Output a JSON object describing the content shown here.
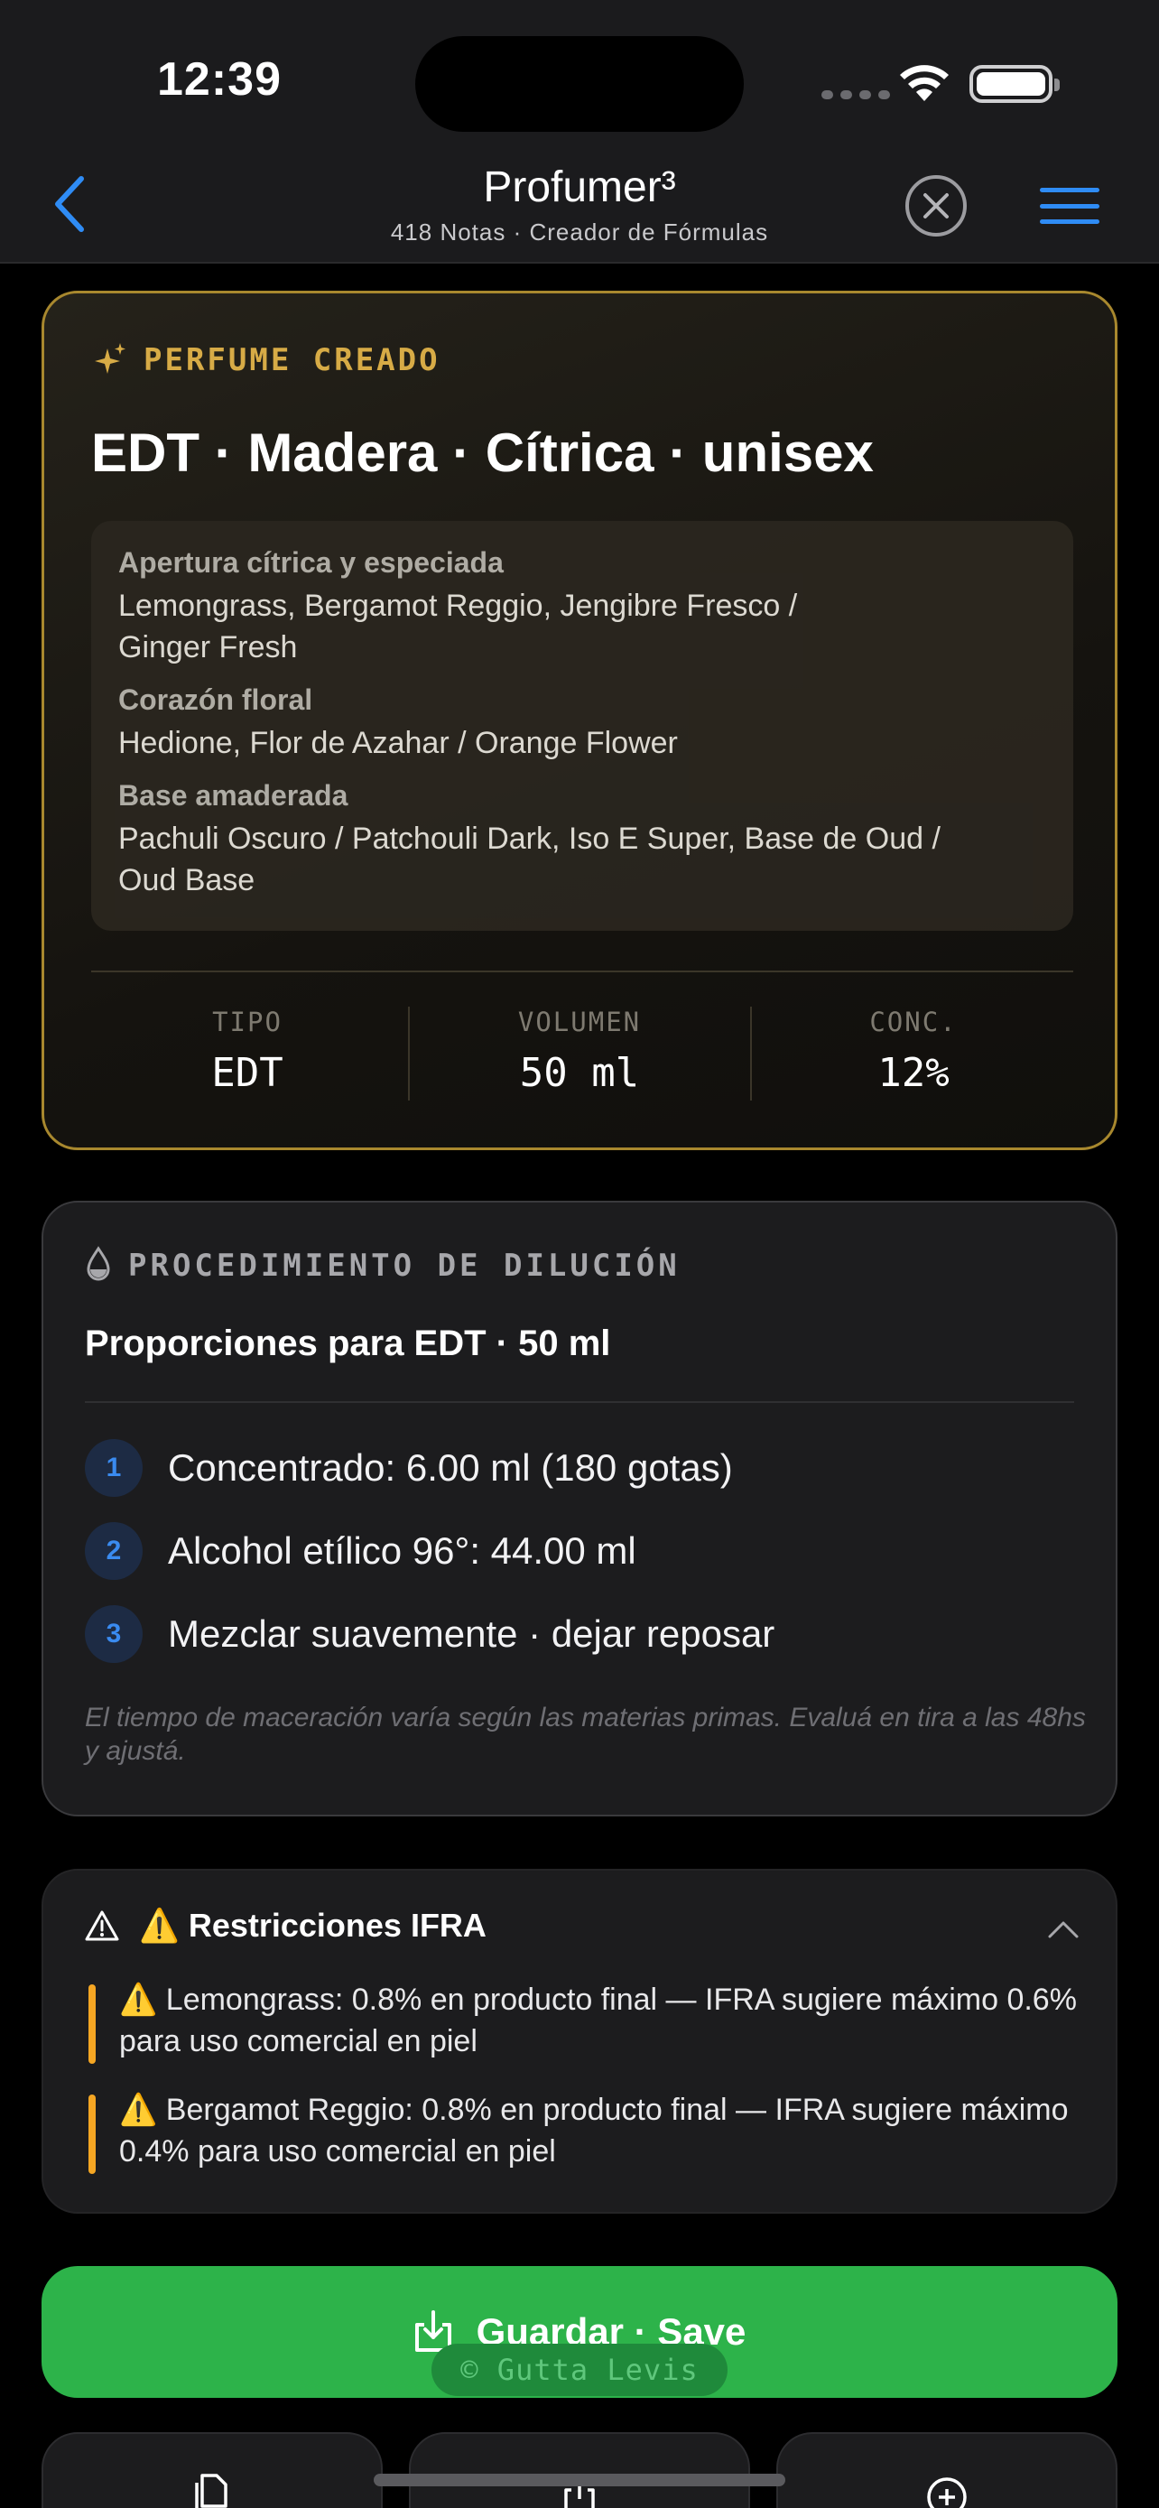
{
  "status_bar": {
    "time": "12:39"
  },
  "nav": {
    "title": "Profumer³",
    "subtitle": "418 Notas · Creador de Fórmulas"
  },
  "perfume": {
    "kicker": "PERFUME CREADO",
    "name": "EDT · Madera · Cítrica · unisex",
    "notes": [
      {
        "heading": "Apertura cítrica y especiada",
        "line1": "Lemongrass, Bergamot Reggio, Jengibre Fresco /",
        "line2": "Ginger Fresh"
      },
      {
        "heading": "Corazón floral",
        "line1": "Hedione, Flor de Azahar / Orange Flower",
        "line2": ""
      },
      {
        "heading": "Base amaderada",
        "line1": "Pachuli Oscuro / Patchouli Dark, Iso E Super, Base de Oud /",
        "line2": "Oud Base"
      }
    ],
    "stats": [
      {
        "label": "TIPO",
        "value": "EDT"
      },
      {
        "label": "VOLUMEN",
        "value": "50 ml"
      },
      {
        "label": "CONC.",
        "value": "12%"
      }
    ]
  },
  "dilution": {
    "kicker": "PROCEDIMIENTO DE DILUCIÓN",
    "title": "Proporciones para EDT · 50 ml",
    "steps": [
      {
        "num": "1",
        "text": "Concentrado: 6.00 ml (180 gotas)"
      },
      {
        "num": "2",
        "text": "Alcohol etílico 96°: 44.00 ml"
      },
      {
        "num": "3",
        "text": "Mezclar suavemente · dejar reposar"
      }
    ],
    "note": "El tiempo de maceración varía según las materias primas. Evaluá en tira a las 48hs y ajustá."
  },
  "ifra": {
    "title": "⚠️ Restricciones IFRA",
    "items": [
      "⚠️ Lemongrass: 0.8% en producto final — IFRA sugiere máximo 0.6% para uso comercial en piel",
      "⚠️ Bergamot Reggio: 0.8% en producto final — IFRA sugiere máximo 0.4% para uso comercial en piel"
    ]
  },
  "actions": {
    "save_label": "Guardar · Save",
    "watermark": "© Gutta Levis"
  },
  "colors": {
    "accent_gold": "#d7ab46",
    "accent_blue": "#2f8cf5",
    "save_green": "#2db34a",
    "warning": "#f5a623"
  },
  "icons": [
    "back-chevron-icon",
    "close-circle-icon",
    "menu-icon",
    "sparkle-icon",
    "drop-icon",
    "warning-icon",
    "chevron-up-icon",
    "download-icon",
    "copy-icon",
    "share-icon",
    "plus-circle-icon"
  ]
}
